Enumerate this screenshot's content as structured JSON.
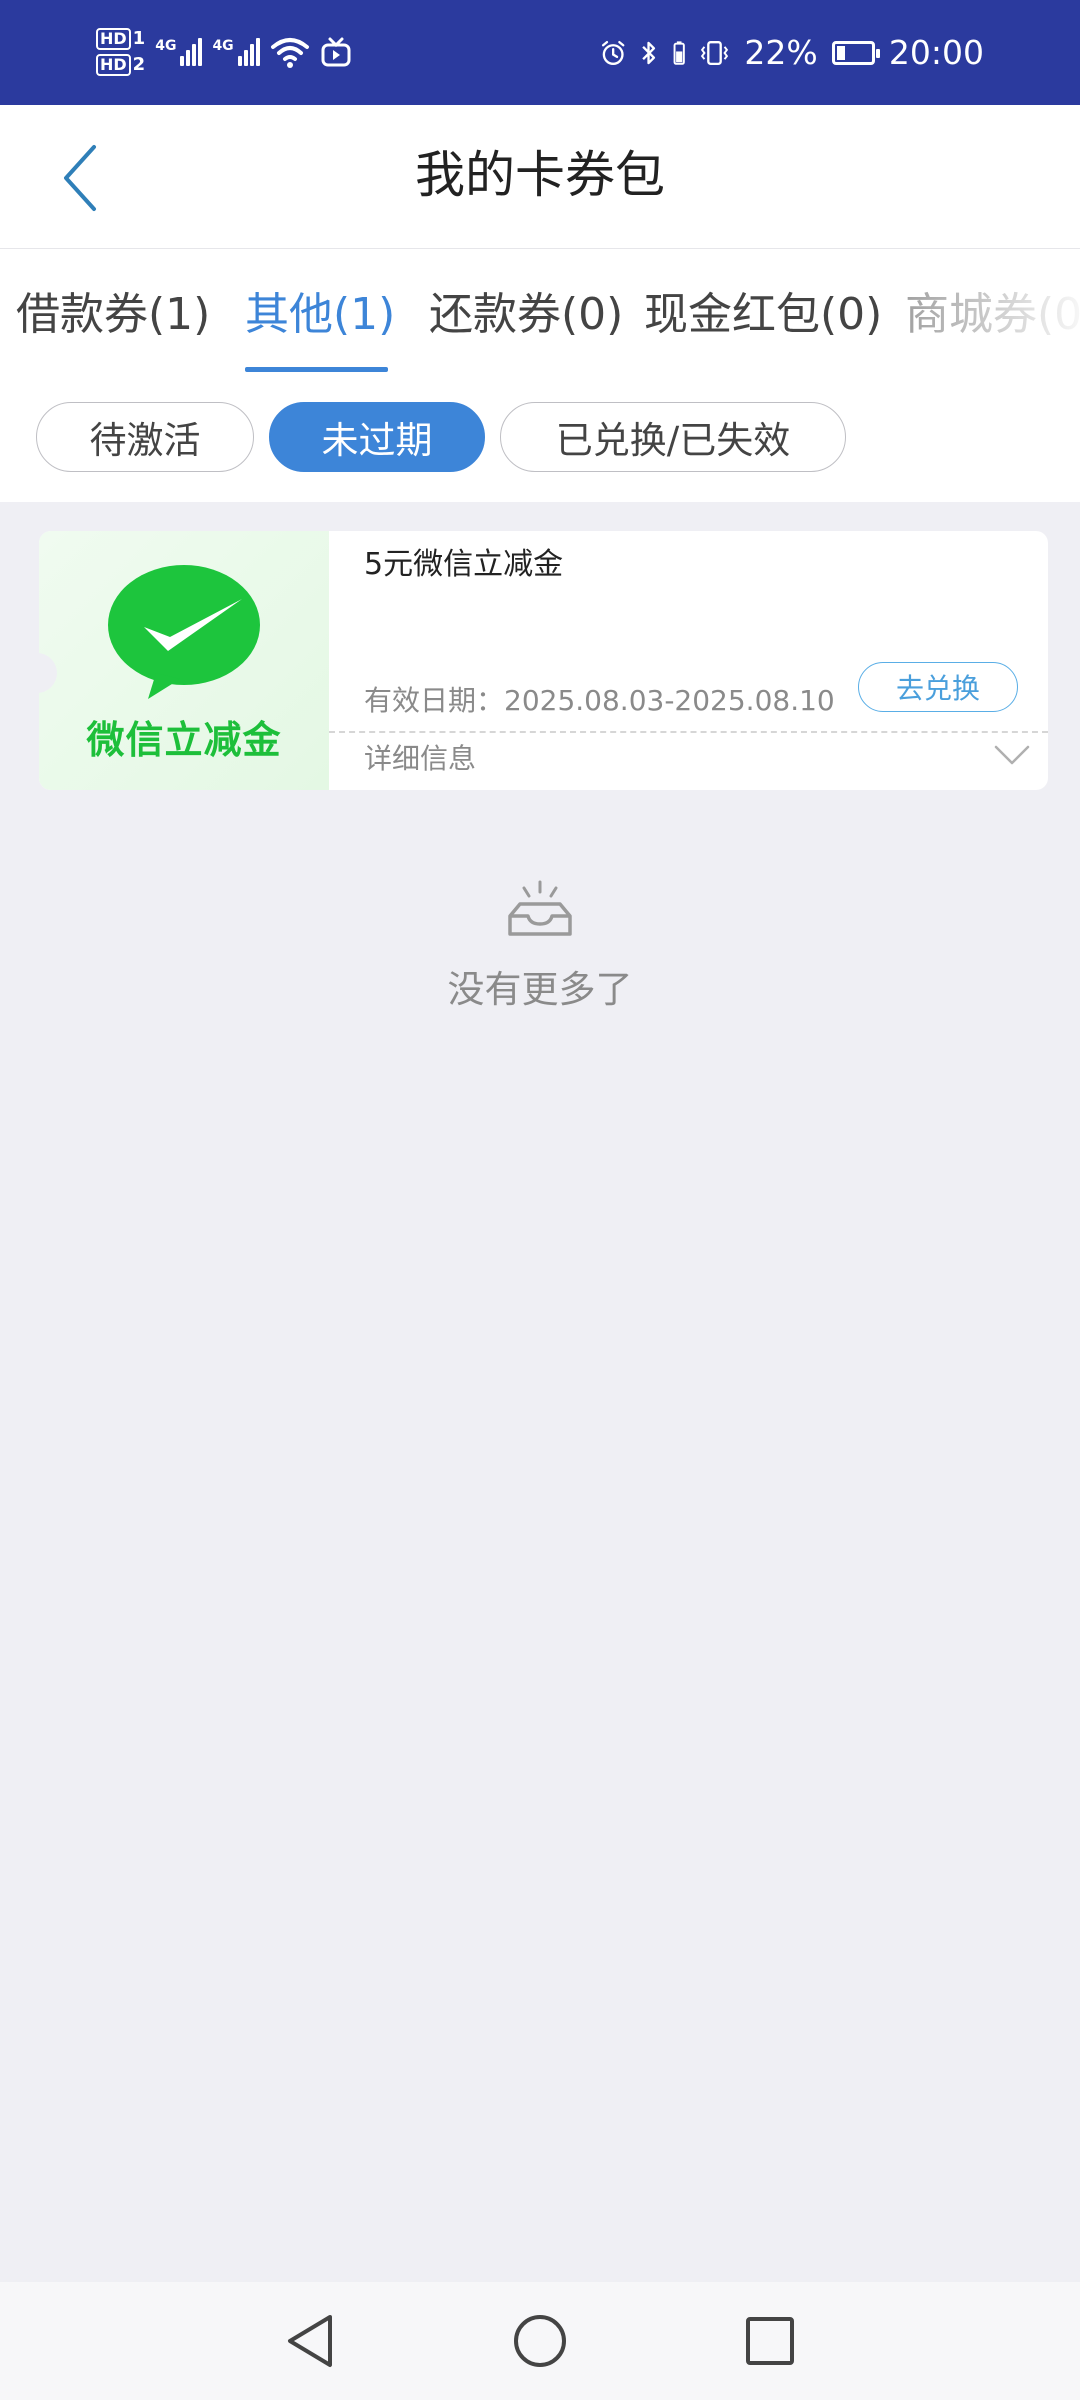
{
  "status_bar": {
    "hd1": "HD",
    "hd1_sim": "1",
    "hd2": "HD",
    "hd2_sim": "2",
    "net1": "4G",
    "net2": "4G",
    "battery_percent": "22%",
    "battery_level": 0.22,
    "time": "20:00",
    "icons": [
      "alarm-icon",
      "bluetooth-icon",
      "vibrate-icon",
      "battery-icon",
      "wifi-icon",
      "tv-icon"
    ]
  },
  "header": {
    "title": "我的卡券包"
  },
  "tabs": [
    {
      "label": "借款券(1)",
      "active": false
    },
    {
      "label": "其他(1)",
      "active": true
    },
    {
      "label": "还款券(0)",
      "active": false
    },
    {
      "label": "现金红包(0)",
      "active": false
    },
    {
      "label": "商城券(0",
      "active": false
    }
  ],
  "filters": [
    {
      "label": "待激活",
      "active": false
    },
    {
      "label": "未过期",
      "active": true
    },
    {
      "label": "已兑换/已失效",
      "active": false
    }
  ],
  "coupon": {
    "brand": "微信立减金",
    "title": "5元微信立减金",
    "validity": "有效日期：2025.08.03-2025.08.10",
    "redeem_label": "去兑换",
    "details_label": "详细信息"
  },
  "empty_state": {
    "text": "没有更多了"
  },
  "colors": {
    "status_bar": "#2b3a9e",
    "accent": "#3d85d8",
    "wechat_green": "#1dbf3a",
    "background": "#efeff4"
  }
}
